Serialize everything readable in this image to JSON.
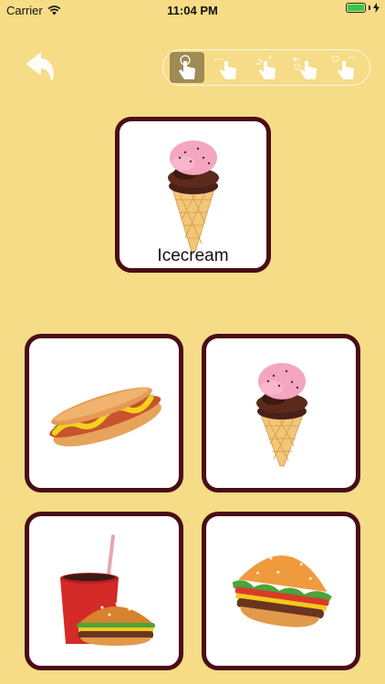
{
  "status_bar": {
    "carrier": "Carrier",
    "time": "11:04 PM"
  },
  "nav": {
    "back_icon": "undo-arrow-icon"
  },
  "modes": [
    {
      "icon": "tap-hand-icon",
      "active": true
    },
    {
      "icon": "swipe-hand-icon",
      "active": false
    },
    {
      "icon": "double-tap-hand-icon",
      "active": false
    },
    {
      "icon": "drag-left-hand-icon",
      "active": false
    },
    {
      "icon": "drag-right-hand-icon",
      "active": false
    }
  ],
  "target": {
    "label": "Icecream",
    "image": "icecream"
  },
  "choices": [
    {
      "image": "hotdog"
    },
    {
      "image": "icecream"
    },
    {
      "image": "burger-and-drink"
    },
    {
      "image": "burger"
    }
  ]
}
